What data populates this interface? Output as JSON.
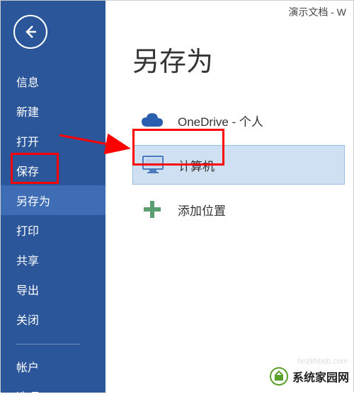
{
  "document_title": "演示文档 - W",
  "page_title": "另存为",
  "sidebar": {
    "items": [
      {
        "label": "信息",
        "key": "info"
      },
      {
        "label": "新建",
        "key": "new"
      },
      {
        "label": "打开",
        "key": "open"
      },
      {
        "label": "保存",
        "key": "save"
      },
      {
        "label": "另存为",
        "key": "saveas",
        "selected": true
      },
      {
        "label": "打印",
        "key": "print"
      },
      {
        "label": "共享",
        "key": "share"
      },
      {
        "label": "导出",
        "key": "export"
      },
      {
        "label": "关闭",
        "key": "close"
      }
    ],
    "bottom_items": [
      {
        "label": "帐户",
        "key": "account"
      },
      {
        "label": "选项",
        "key": "options"
      }
    ]
  },
  "locations": {
    "onedrive": {
      "label": "OneDrive - 个人"
    },
    "computer": {
      "label": "计算机",
      "highlighted": true
    },
    "add": {
      "label": "添加位置"
    }
  },
  "watermark": {
    "text": "系统家园网",
    "url": "hnzkhbsb.com"
  }
}
